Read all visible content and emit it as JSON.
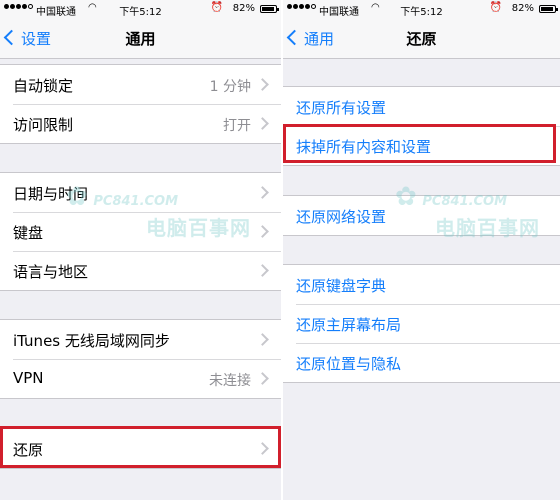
{
  "left_screen": {
    "status_bar": {
      "carrier": "中国联通",
      "time": "下午5:12",
      "battery": "82%",
      "battery_level": 0.82
    },
    "nav": {
      "back_label": "设置",
      "title": "通用"
    },
    "group1": [
      {
        "label": "自动锁定",
        "value": "1 分钟"
      },
      {
        "label": "访问限制",
        "value": "打开"
      }
    ],
    "group2": [
      {
        "label": "日期与时间"
      },
      {
        "label": "键盘"
      },
      {
        "label": "语言与地区"
      }
    ],
    "group3": [
      {
        "label": "iTunes 无线局域网同步"
      },
      {
        "label": "VPN",
        "value": "未连接"
      }
    ],
    "group4": [
      {
        "label": "还原"
      }
    ],
    "watermark": {
      "site": "PC841.COM",
      "brand": "电脑百事网"
    }
  },
  "right_screen": {
    "status_bar": {
      "carrier": "中国联通",
      "time": "下午5:12",
      "battery": "82%",
      "battery_level": 0.82
    },
    "nav": {
      "back_label": "通用",
      "title": "还原"
    },
    "group1": [
      {
        "label": "还原所有设置"
      },
      {
        "label": "抹掉所有内容和设置"
      }
    ],
    "group2": [
      {
        "label": "还原网络设置"
      }
    ],
    "group3": [
      {
        "label": "还原键盘字典"
      },
      {
        "label": "还原主屏幕布局"
      },
      {
        "label": "还原位置与隐私"
      }
    ],
    "watermark": {
      "site": "PC841.COM",
      "brand": "电脑百事网"
    }
  },
  "colors": {
    "accent": "#147efb",
    "highlight": "#d11f2c",
    "background": "#efeff4"
  }
}
